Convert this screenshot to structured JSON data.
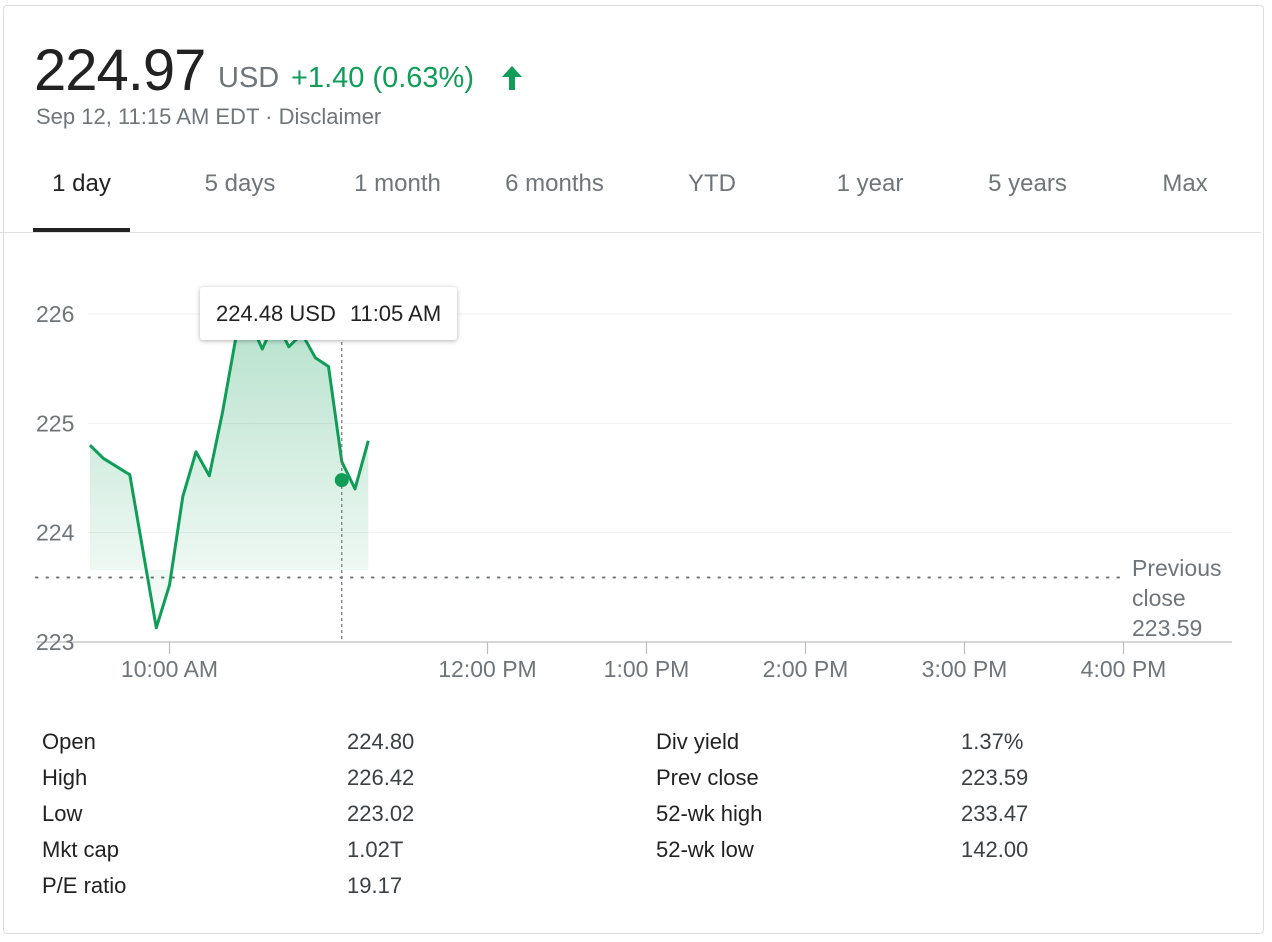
{
  "quote": {
    "price": "224.97",
    "currency": "USD",
    "change": "+1.40 (0.63%)",
    "timestamp": "Sep 12, 11:15 AM EDT",
    "separator": "·",
    "disclaimer": "Disclaimer"
  },
  "colors": {
    "positive": "#0f9d58",
    "text_primary": "#222222",
    "text_secondary": "#70757a"
  },
  "icons": {
    "trend": "arrow-up-icon"
  },
  "tabs": [
    {
      "label": "1 day",
      "active": true
    },
    {
      "label": "5 days"
    },
    {
      "label": "1 month"
    },
    {
      "label": "6 months"
    },
    {
      "label": "YTD"
    },
    {
      "label": "1 year"
    },
    {
      "label": "5 years"
    },
    {
      "label": "Max"
    }
  ],
  "tooltip": {
    "price": "224.48 USD",
    "time": "11:05 AM"
  },
  "chart_data": {
    "type": "line",
    "y_ticks": [
      "226",
      "225",
      "224",
      "223"
    ],
    "x_ticks": [
      "10:00 AM",
      "12:00 PM",
      "1:00 PM",
      "2:00 PM",
      "3:00 PM",
      "4:00 PM"
    ],
    "ylim": [
      223,
      226
    ],
    "xlim": [
      "9:30 AM",
      "4:00 PM"
    ],
    "grid": true,
    "previous_close": {
      "label_line1": "Previous",
      "label_line2": "close",
      "value": 223.59
    },
    "hover_point": {
      "time": "11:05 AM",
      "value": 224.48
    },
    "series": [
      {
        "x": [
          "9:30 AM",
          "9:35 AM",
          "9:45 AM",
          "9:55 AM",
          "10:00 AM",
          "10:05 AM",
          "10:10 AM",
          "10:15 AM",
          "10:20 AM",
          "10:25 AM",
          "10:30 AM",
          "10:35 AM",
          "10:40 AM",
          "10:45 AM",
          "10:50 AM",
          "10:55 AM",
          "11:00 AM",
          "11:05 AM",
          "11:10 AM",
          "11:15 AM"
        ],
        "values": [
          224.8,
          224.68,
          224.53,
          223.13,
          223.52,
          224.33,
          224.74,
          224.52,
          225.1,
          225.78,
          225.95,
          225.68,
          225.95,
          225.7,
          225.82,
          225.6,
          225.52,
          224.65,
          224.4,
          224.84
        ]
      }
    ]
  },
  "stats": {
    "left": [
      {
        "label": "Open",
        "value": "224.80"
      },
      {
        "label": "High",
        "value": "226.42"
      },
      {
        "label": "Low",
        "value": "223.02"
      },
      {
        "label": "Mkt cap",
        "value": "1.02T"
      },
      {
        "label": "P/E ratio",
        "value": "19.17"
      }
    ],
    "right": [
      {
        "label": "Div yield",
        "value": "1.37%"
      },
      {
        "label": "Prev close",
        "value": "223.59"
      },
      {
        "label": "52-wk high",
        "value": "233.47"
      },
      {
        "label": "52-wk low",
        "value": "142.00"
      }
    ]
  }
}
